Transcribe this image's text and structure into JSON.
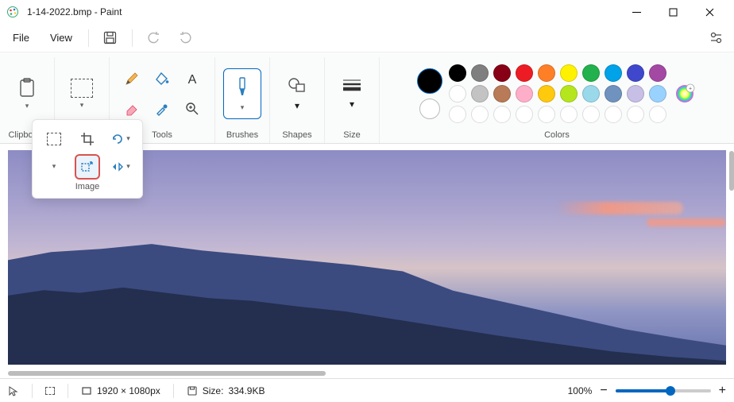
{
  "title": "1-14-2022.bmp - Paint",
  "menu": {
    "file": "File",
    "view": "View"
  },
  "ribbon": {
    "clipboard": "Clipboard",
    "image": "Image",
    "tools": "Tools",
    "brushes": "Brushes",
    "shapes": "Shapes",
    "size": "Size",
    "colors": "Colors"
  },
  "palette_row1": [
    "#000000",
    "#7f7f7f",
    "#880015",
    "#ed1c24",
    "#ff7f27",
    "#fff200",
    "#22b14c",
    "#00a2e8",
    "#3f48cc",
    "#a349a4"
  ],
  "palette_row2": [
    "#ffffff",
    "#c3c3c3",
    "#b97a57",
    "#ffaec9",
    "#ffc90e",
    "#b5e61d",
    "#99d9ea",
    "#7092be",
    "#c8bfe7",
    "#9ad2ff"
  ],
  "current_color": "#000000",
  "status": {
    "dimensions": "1920 × 1080px",
    "size_label": "Size:",
    "size_value": "334.9KB",
    "zoom": "100%"
  }
}
